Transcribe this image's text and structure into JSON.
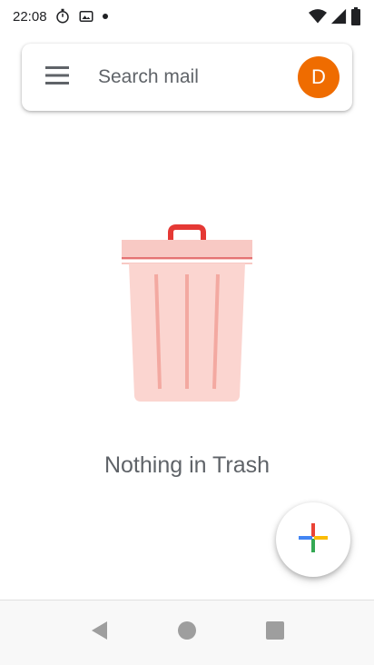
{
  "status_bar": {
    "time": "22:08",
    "icons": [
      "stopwatch-icon",
      "photos-icon",
      "notification-dot-icon",
      "wifi-icon",
      "signal-icon",
      "battery-icon"
    ]
  },
  "search": {
    "placeholder": "Search mail",
    "avatar_letter": "D",
    "avatar_color": "#ef6c00"
  },
  "empty_state": {
    "message": "Nothing in Trash",
    "illustration": "trash-can-illustration"
  },
  "fab": {
    "icon": "compose-plus-icon"
  },
  "nav_bar": {
    "buttons": [
      "back-icon",
      "home-icon",
      "recents-icon"
    ]
  }
}
